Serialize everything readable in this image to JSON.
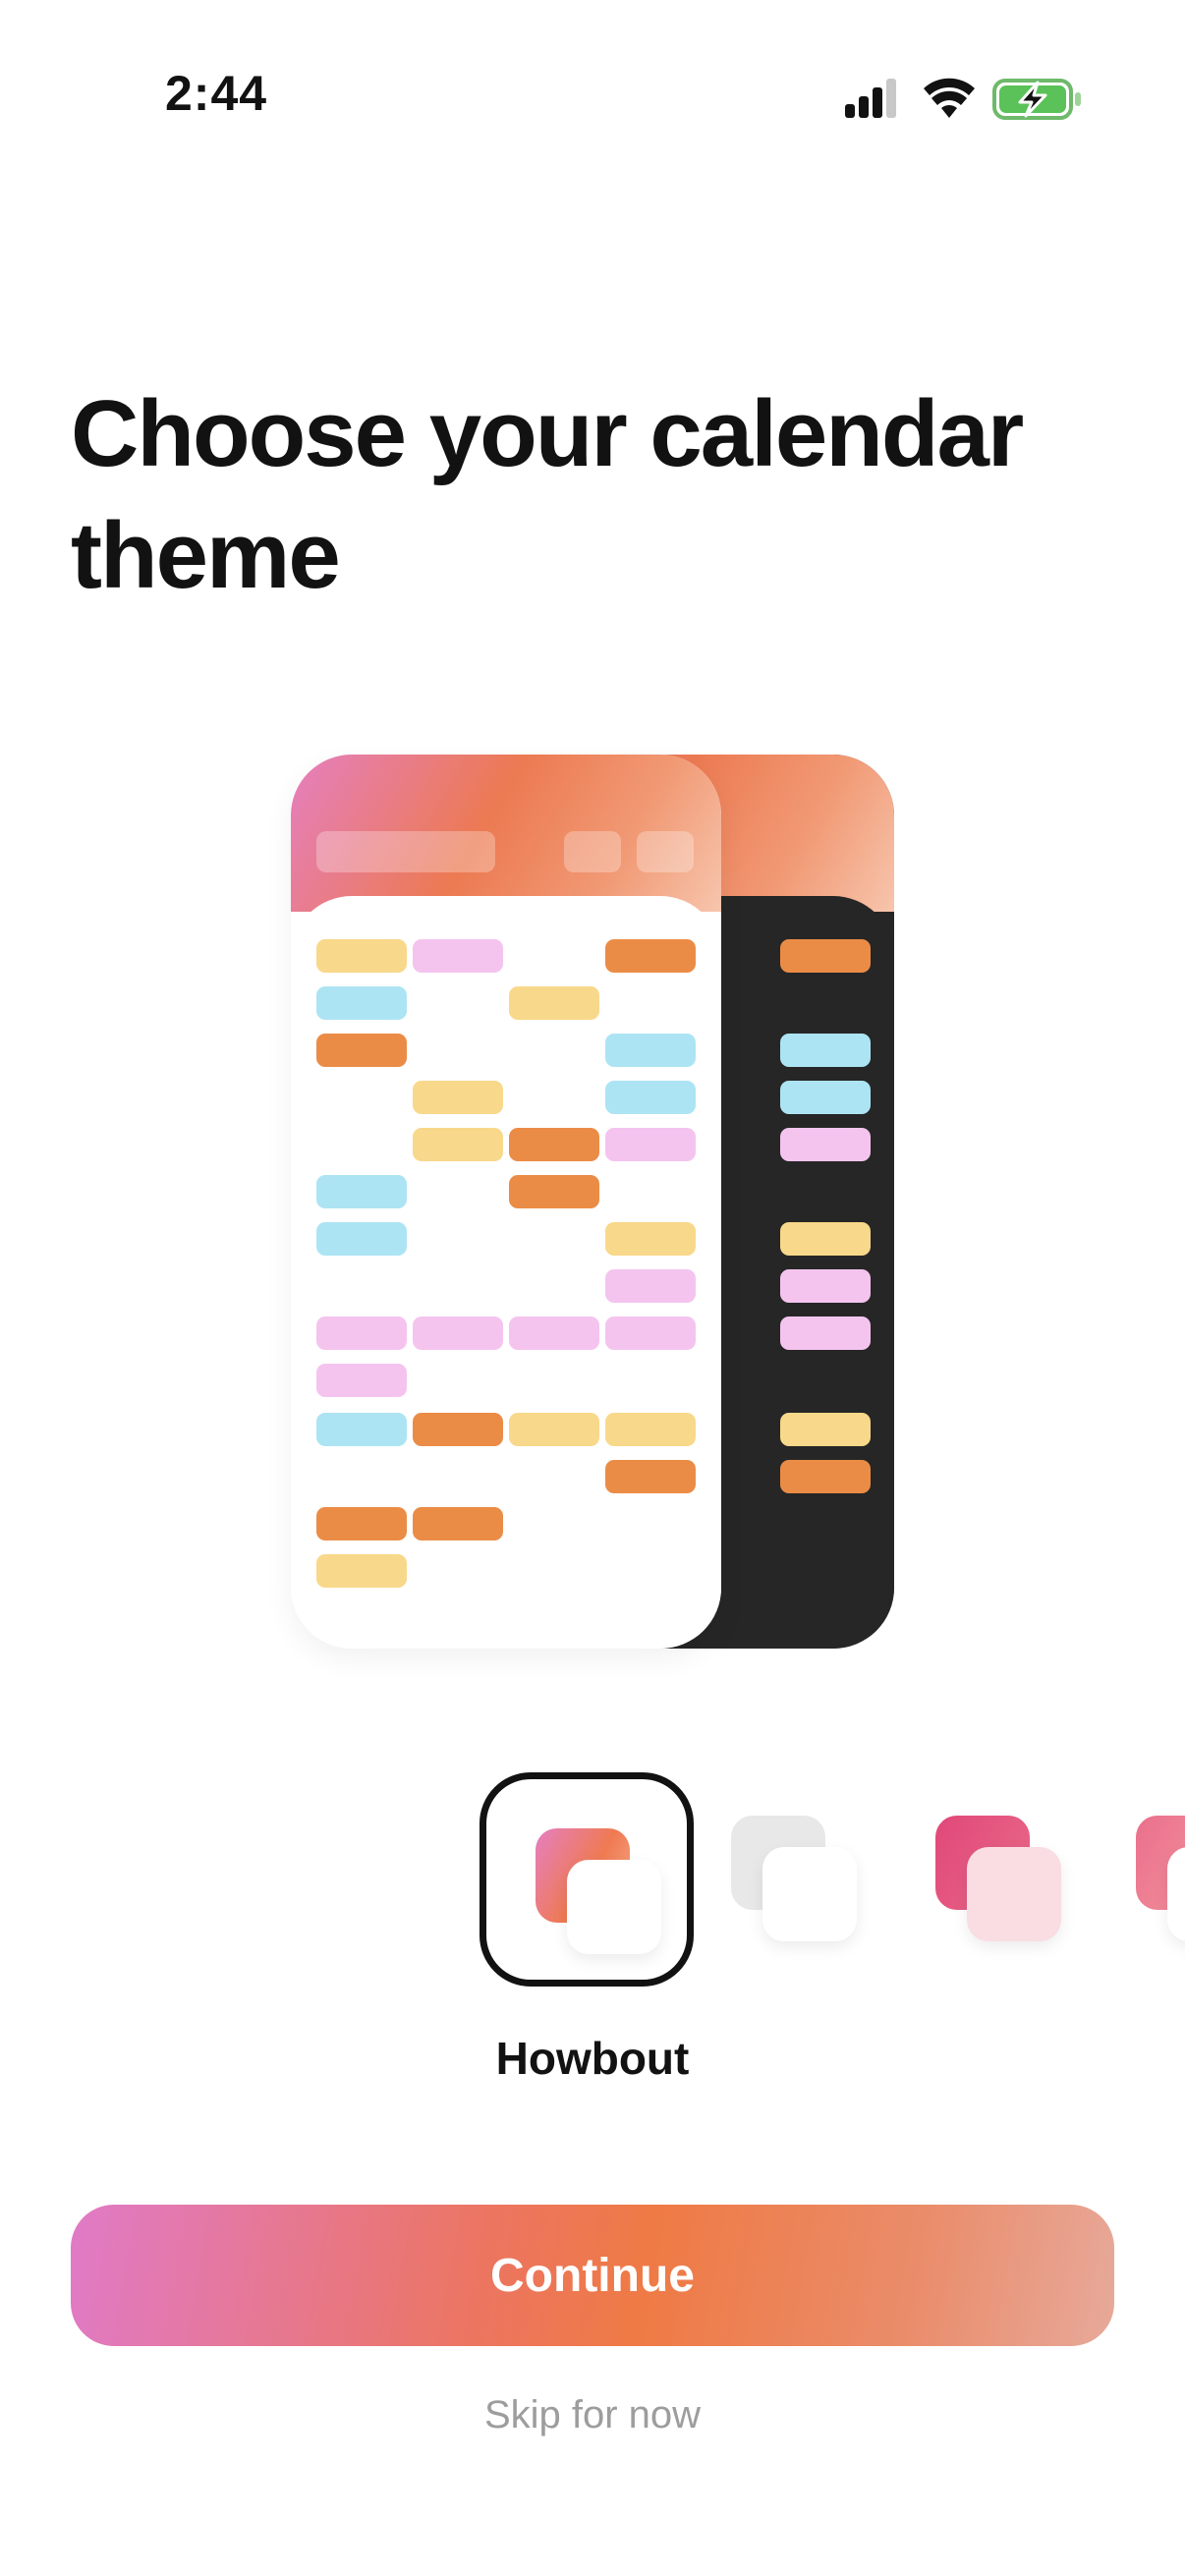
{
  "status_bar": {
    "time": "2:44",
    "icons": [
      "cellular-signal-icon",
      "wifi-icon",
      "battery-charging-icon"
    ],
    "battery_color": "#5ac259"
  },
  "page": {
    "title": "Choose your calendar theme"
  },
  "preview": {
    "header_gradient": [
      "#e57fc0",
      "#ec7a52",
      "#f7c5ad"
    ],
    "front_background": "#ffffff",
    "back_background": "#262626",
    "event_colors": {
      "yellow": "#f8d88a",
      "pink": "#f4c4ef",
      "orange": "#eb8c46",
      "blue": "#ade4f4"
    }
  },
  "theme_selector": {
    "selected_index": 0,
    "selected_label": "Howbout",
    "options": [
      {
        "id": "howbout",
        "back_color": "#ef7a52",
        "front_color": "#ffffff"
      },
      {
        "id": "light",
        "back_color": "#e8e8e8",
        "front_color": "#ffffff"
      },
      {
        "id": "pink",
        "back_color": "#e2587f",
        "front_color": "#f9dde2"
      },
      {
        "id": "rose",
        "back_color": "#ee7f96",
        "front_color": "#ffffff"
      }
    ]
  },
  "actions": {
    "continue_label": "Continue",
    "skip_label": "Skip for now"
  }
}
